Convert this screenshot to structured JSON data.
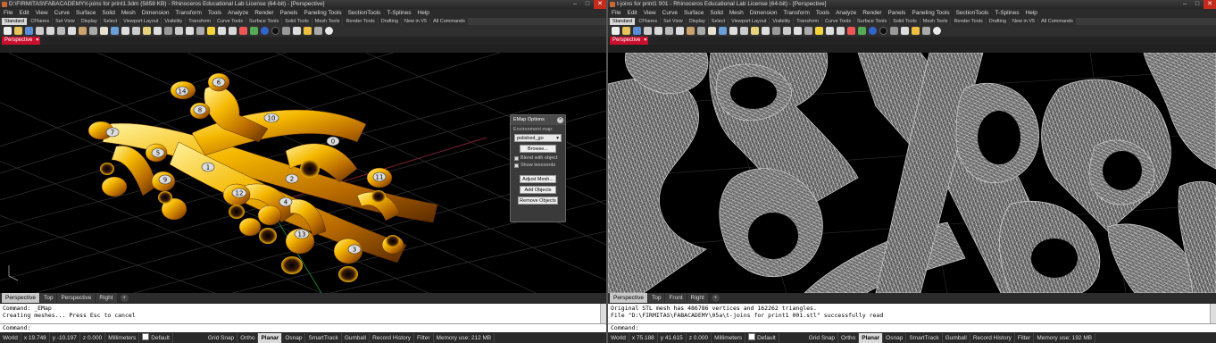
{
  "left": {
    "title": "D:\\FIRMITAS\\FABACADEMY\\t-joins for print1.3dm (5858 KB) - Rhinoceros Educational Lab License (64-bit) - [Perspective]",
    "menu": [
      "File",
      "Edit",
      "View",
      "Curve",
      "Surface",
      "Solid",
      "Mesh",
      "Dimension",
      "Transform",
      "Tools",
      "Analyze",
      "Render",
      "Panels",
      "Paneling Tools",
      "SectionTools",
      "T-Splines",
      "Help"
    ],
    "toolbar_tabs": [
      "Standard",
      "CPlanes",
      "Set View",
      "Display",
      "Select",
      "Viewport Layout",
      "Visibility",
      "Transform",
      "Curve Tools",
      "Surface Tools",
      "Solid Tools",
      "Mesh Tools",
      "Render Tools",
      "Drafting",
      "New in V5",
      "All Commands"
    ],
    "viewport_label": "Perspective",
    "joint_labels": [
      "14",
      "6",
      "8",
      "10",
      "7",
      "0",
      "5",
      "1",
      "9",
      "2",
      "12",
      "4",
      "11",
      "13",
      "3"
    ],
    "emap": {
      "title": "EMap Options",
      "env_label": "Environment map:",
      "selected": "polished_go",
      "browse": "Browse...",
      "blend": "Blend with object",
      "show_texcoords": "Show texcoords",
      "adjust_mesh": "Adjust Mesh...",
      "add_objects": "Add Objects",
      "remove_objects": "Remove Objects"
    },
    "view_tabs": [
      "Perspective",
      "Top",
      "Perspective",
      "Right"
    ],
    "cmd_history": [
      "Command: _EMap",
      "Creating meshes... Press Esc to cancel"
    ],
    "cmd_prompt": "Command:",
    "status": {
      "world": "World",
      "x": "x 19.748",
      "y": "y -10.197",
      "z": "z 0.000",
      "units": "Millimeters",
      "layer": "Default",
      "grid_snap": "Grid Snap",
      "ortho": "Ortho",
      "planar": "Planar",
      "osnap": "Osnap",
      "smarttrack": "SmartTrack",
      "gumball": "Gumball",
      "record_history": "Record History",
      "filter": "Filter",
      "memory": "Memory use: 212 MB"
    }
  },
  "right": {
    "title": "t-joins for print1 001 - Rhinoceros Educational Lab License (64-bit) - [Perspective]",
    "menu": [
      "File",
      "Edit",
      "View",
      "Curve",
      "Surface",
      "Solid",
      "Mesh",
      "Dimension",
      "Transform",
      "Tools",
      "Analyze",
      "Render",
      "Panels",
      "Paneling Tools",
      "SectionTools",
      "T-Splines",
      "Help"
    ],
    "toolbar_tabs": [
      "Standard",
      "CPlanes",
      "Set View",
      "Display",
      "Select",
      "Viewport Layout",
      "Visibility",
      "Transform",
      "Curve Tools",
      "Surface Tools",
      "Solid Tools",
      "Mesh Tools",
      "Render Tools",
      "Drafting",
      "New in V5",
      "All Commands"
    ],
    "viewport_label": "Perspective",
    "view_tabs": [
      "Perspective",
      "Top",
      "Front",
      "Right"
    ],
    "cmd_history": [
      "Original STL mesh has 486786 vertices and 162262 triangles.",
      "File \"D:\\FIRMITAS\\FABACADEMY\\05a\\t-joins for print1 001.stl\" successfully read"
    ],
    "cmd_prompt": "Command:",
    "status": {
      "world": "World",
      "x": "x 75.188",
      "y": "y 41.615",
      "z": "z 0.000",
      "units": "Millimeters",
      "layer": "Default",
      "grid_snap": "Grid Snap",
      "ortho": "Ortho",
      "planar": "Planar",
      "osnap": "Osnap",
      "smarttrack": "SmartTrack",
      "gumball": "Gumball",
      "record_history": "Record History",
      "filter": "Filter",
      "memory": "Memory use: 192 MB"
    }
  },
  "colors": {
    "accent": "#c8102e",
    "gold": "#f0b000",
    "wire": "#d8d8d8"
  }
}
